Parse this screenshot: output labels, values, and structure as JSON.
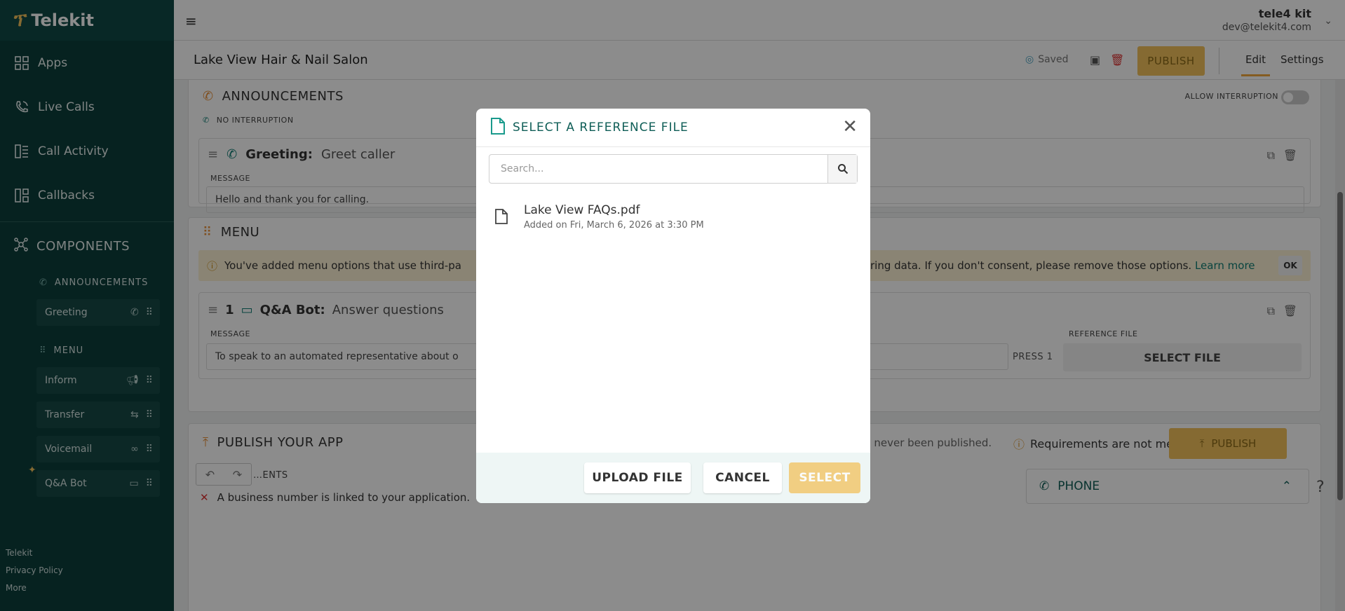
{
  "app": {
    "brand": "Telekit"
  },
  "sidebar": {
    "nav": [
      {
        "label": "Apps",
        "icon": "grid-icon"
      },
      {
        "label": "Live Calls",
        "icon": "phone-call-icon"
      },
      {
        "label": "Call Activity",
        "icon": "activity-icon"
      },
      {
        "label": "Callbacks",
        "icon": "callbacks-icon"
      }
    ],
    "components_label": "COMPONENTS",
    "announcements_label": "ANNOUNCEMENTS",
    "menu_label": "MENU",
    "chips_announcements": [
      {
        "label": "Greeting"
      }
    ],
    "chips_menu": [
      {
        "label": "Inform"
      },
      {
        "label": "Transfer"
      },
      {
        "label": "Voicemail"
      },
      {
        "label": "Q&A Bot"
      }
    ],
    "footer": [
      "Telekit",
      "Privacy Policy",
      "More"
    ]
  },
  "user": {
    "name": "tele4 kit",
    "email": "dev@telekit4.com"
  },
  "appbar": {
    "title": "Lake View Hair & Nail Salon",
    "saved": "Saved",
    "publish": "PUBLISH",
    "tabs": [
      "Edit",
      "Settings"
    ]
  },
  "announcements_section": {
    "title": "ANNOUNCEMENTS",
    "allow_interruption": "ALLOW INTERRUPTION",
    "no_interruption": "NO INTERRUPTION",
    "greeting_label": "Greeting:",
    "greeting_title": "Greet caller",
    "message_label": "MESSAGE",
    "message_value": "Hello and thank you for calling."
  },
  "menu_section": {
    "title": "MENU",
    "notice_start": "You've added menu options that use third-pa",
    "notice_end": "ring data. If you don't consent, please remove those options.",
    "learn_more": "Learn more",
    "ok": "OK",
    "item_number": "1",
    "item_label": "Q&A Bot:",
    "item_title": "Answer questions",
    "message_label": "MESSAGE",
    "message_value": "To speak to an automated representative about o",
    "press": "PRESS 1",
    "reference_label": "REFERENCE FILE",
    "select_file": "SELECT FILE"
  },
  "publish_section": {
    "title": "PUBLISH YOUR APP",
    "status": "App has never been published.",
    "requirements": "Requirements are not met",
    "publish": "PUBLISH",
    "requirements_label": "…ENTS",
    "business_req": "A business number is linked to your application.",
    "phone": "PHONE"
  },
  "modal": {
    "title": "SELECT A REFERENCE FILE",
    "search_placeholder": "Search...",
    "files": [
      {
        "name": "Lake View FAQs.pdf",
        "added": "Added on Fri, March 6, 2026 at 3:30 PM"
      }
    ],
    "upload": "UPLOAD FILE",
    "cancel": "CANCEL",
    "select": "SELECT"
  }
}
